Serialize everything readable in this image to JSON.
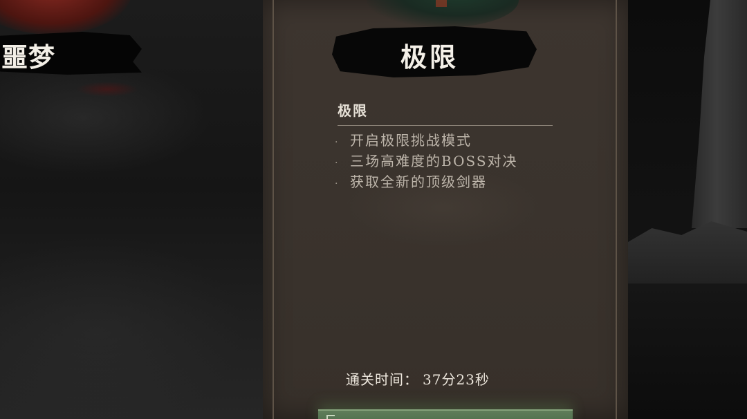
{
  "left_card": {
    "title": "噩梦"
  },
  "center_card": {
    "title": "极限",
    "section_heading": "极限",
    "bullets": [
      "开启极限挑战模式",
      "三场高难度的BOSS对决",
      "获取全新的顶级剑器"
    ],
    "clear_time_label": "通关时间：",
    "clear_time_value": "37分23秒"
  },
  "colors": {
    "card_background": "#3a332d",
    "banner_ink": "#070707",
    "confirm_button": "#4f6f4b",
    "left_accent_red": "#8e1f18"
  },
  "icons": {
    "bullet": "·"
  }
}
